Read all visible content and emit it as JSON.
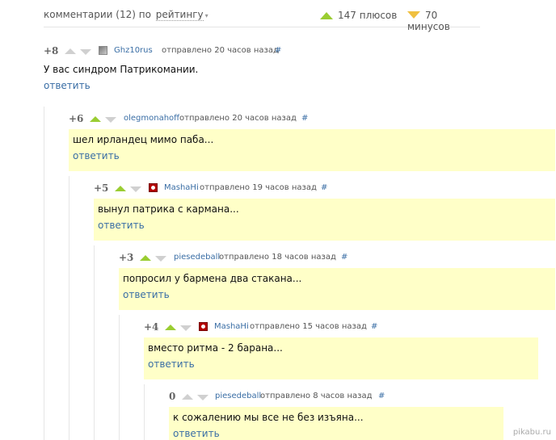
{
  "header": {
    "comments_label": "комментарии (12) по",
    "sort_label": "рейтингу",
    "caret": "▾",
    "plus_label": "147 плюсов",
    "minus_label": "70 минусов"
  },
  "comments": [
    {
      "score": "+8",
      "author": "Ghz10rus",
      "posted": "отправлено 20 часов назад",
      "hash": "#",
      "text": "У вас синдром Патрикомании.",
      "reply": "ответить"
    },
    {
      "score": "+6",
      "author": "olegmonahoff",
      "posted": "отправлено 20 часов назад",
      "hash": "#",
      "text": "шел ирландец мимо паба...",
      "reply": "ответить"
    },
    {
      "score": "+5",
      "author": "MashaHi",
      "posted": "отправлено 19 часов назад",
      "hash": "#",
      "text": "вынул патрика с кармана...",
      "reply": "ответить"
    },
    {
      "score": "+3",
      "author": "piesedeball",
      "posted": "отправлено 18 часов назад",
      "hash": "#",
      "text": "попросил у бармена два стакана...",
      "reply": "ответить"
    },
    {
      "score": "+4",
      "author": "MashaHi",
      "posted": "отправлено 15 часов назад",
      "hash": "#",
      "text": "вместо ритма - 2 барана...",
      "reply": "ответить"
    },
    {
      "score": "0",
      "author": "piesedeball",
      "posted": "отправлено 8 часов назад",
      "hash": "#",
      "text": "к сожалению мы все не без изъяна...",
      "reply": "ответить"
    }
  ],
  "watermark": "pikabu.ru",
  "colors": {
    "vote_up": "#9acd32",
    "vote_down": "#f0c040",
    "highlight": "#ffffc8",
    "link": "#3a6ea5"
  }
}
